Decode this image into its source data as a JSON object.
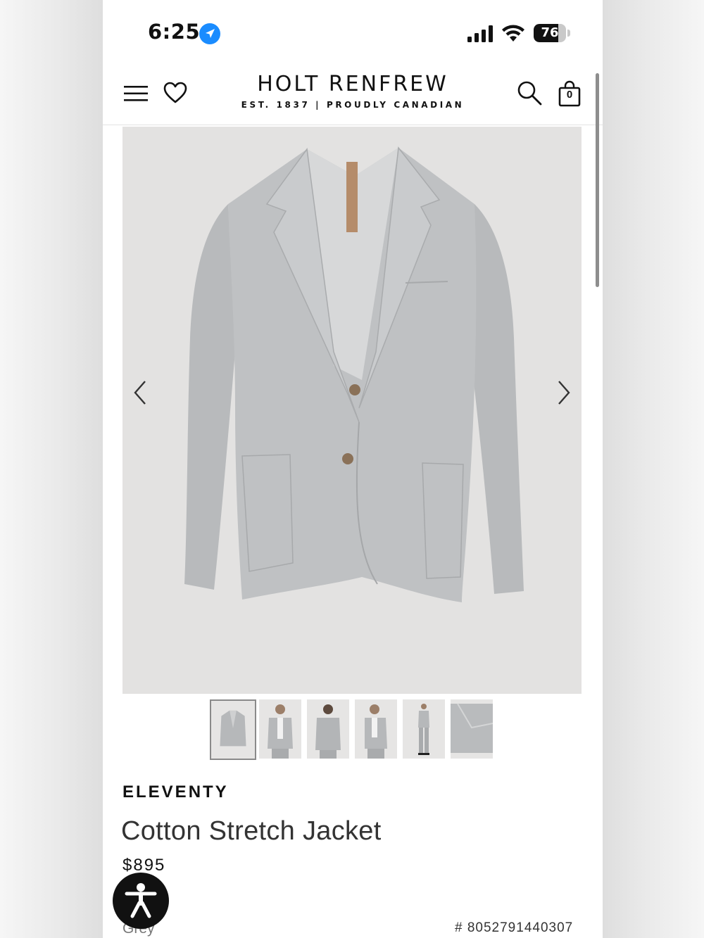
{
  "status_bar": {
    "time": "6:25",
    "battery_level": "76",
    "battery_fraction": 0.76,
    "icons": [
      "location-arrow-icon",
      "cellular-signal-icon",
      "wifi-icon",
      "battery-icon"
    ]
  },
  "header": {
    "brand_name": "HOLT RENFREW",
    "tagline": "EST. 1837 | PROUDLY CANADIAN",
    "bag_count": "0",
    "icons": [
      "hamburger-menu-icon",
      "heart-icon",
      "search-icon",
      "shopping-bag-icon"
    ]
  },
  "gallery": {
    "thumbnail_count": 6,
    "active_index": 0,
    "icons": [
      "chevron-left-icon",
      "chevron-right-icon"
    ]
  },
  "product": {
    "brand": "ELEVENTY",
    "name": "Cotton Stretch Jacket",
    "price": "$895",
    "color": "Grey",
    "sku": "# 8052791440307"
  },
  "colors": {
    "jacket": "#b9bbbd",
    "image_background": "#e3e2e1",
    "text_primary": "#111111"
  }
}
